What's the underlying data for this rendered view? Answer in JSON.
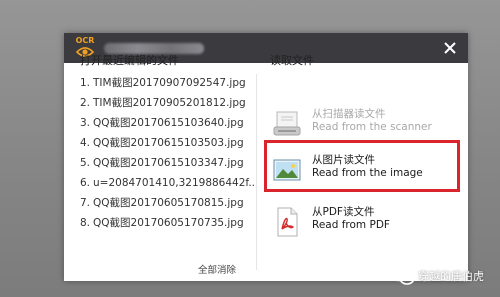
{
  "dialog": {
    "logo_text": "OCR",
    "left_title": "打开最近编辑的文件",
    "right_title": "读取文件",
    "recent_files": [
      {
        "idx": "1.",
        "name": "TIM截图20170907092547.jpg"
      },
      {
        "idx": "2.",
        "name": "TIM截图20170905201812.jpg"
      },
      {
        "idx": "3.",
        "name": "QQ截图20170615103640.jpg"
      },
      {
        "idx": "4.",
        "name": "QQ截图20170615103503.jpg"
      },
      {
        "idx": "5.",
        "name": "QQ截图20170615103347.jpg"
      },
      {
        "idx": "6.",
        "name": "u=2084701410,3219886442f..."
      },
      {
        "idx": "7.",
        "name": "QQ截图20170605170815.jpg"
      },
      {
        "idx": "8.",
        "name": "QQ截图20170605170735.jpg"
      }
    ],
    "clear_all": "全部消除",
    "options": {
      "scanner": {
        "line1": "从扫描器读文件",
        "line2": "Read from the scanner",
        "icon": "scanner-icon",
        "state": "disabled"
      },
      "image": {
        "line1": "从图片读文件",
        "line2": "Read from the image",
        "icon": "image-icon",
        "state": "highlighted"
      },
      "pdf": {
        "line1": "从PDF读文件",
        "line2": "Read from PDF",
        "icon": "pdf-icon",
        "state": "normal"
      }
    }
  },
  "watermark": {
    "text": "穿越的唐伯虎"
  },
  "colors": {
    "titlebar": "#3a3a3f",
    "highlight": "#d9242b",
    "logo": "#f0a020",
    "disabled_text": "#a8a8a8"
  }
}
